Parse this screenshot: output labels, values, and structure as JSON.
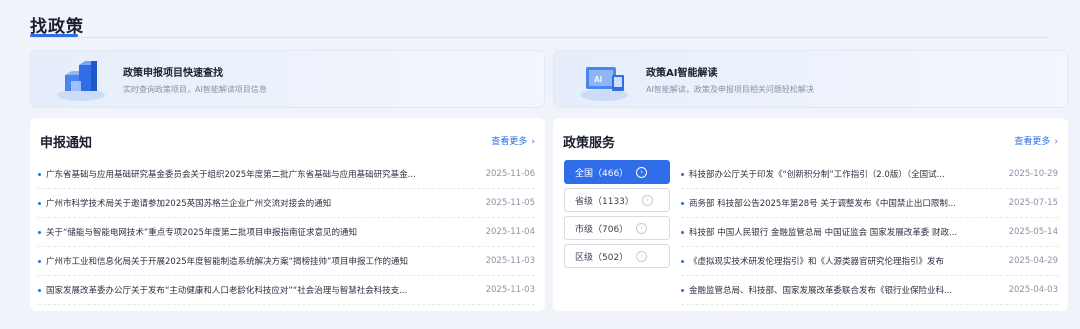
{
  "page": {
    "title": "找政策"
  },
  "banners": [
    {
      "title": "政策申报项目快速查找",
      "subtitle": "实时查询政策项目，AI智能解读项目信息"
    },
    {
      "title": "政策AI智能解读",
      "subtitle": "AI智能解读，政策及申报项目相关问题轻松解决"
    }
  ],
  "notices": {
    "title": "申报通知",
    "see_more": "查看更多",
    "items": [
      {
        "text": "广东省基础与应用基础研究基金委员会关于组织2025年度第二批广东省基础与应用基础研究基金...",
        "date": "2025-11-06"
      },
      {
        "text": "广州市科学技术局关于邀请参加2025英国苏格兰企业广州交流对接会的通知",
        "date": "2025-11-05"
      },
      {
        "text": "关于“储能与智能电网技术”重点专项2025年度第二批项目申报指南征求意见的通知",
        "date": "2025-11-04"
      },
      {
        "text": "广州市工业和信息化局关于开展2025年度智能制造系统解决方案“揭榜挂帅”项目申报工作的通知",
        "date": "2025-11-03"
      },
      {
        "text": "国家发展改革委办公厅关于发布“主动健康和人口老龄化科技应对”“社会治理与智慧社会科技支...",
        "date": "2025-11-03"
      }
    ]
  },
  "services": {
    "title": "政策服务",
    "see_more": "查看更多",
    "tabs": [
      {
        "label": "全国（466）",
        "active": true
      },
      {
        "label": "省级（1133）",
        "active": false
      },
      {
        "label": "市级（706）",
        "active": false
      },
      {
        "label": "区级（502）",
        "active": false
      }
    ],
    "items": [
      {
        "text": "科技部办公厅关于印发《“创新积分制”工作指引（2.0版）（全国试...",
        "date": "2025-10-29"
      },
      {
        "text": "商务部 科技部公告2025年第28号 关于调整发布《中国禁止出口限制...",
        "date": "2025-07-15"
      },
      {
        "text": "科技部 中国人民银行 金融监管总局 中国证监会 国家发展改革委 财政...",
        "date": "2025-05-14"
      },
      {
        "text": "《虚拟现实技术研发伦理指引》和《人源类器官研究伦理指引》发布",
        "date": "2025-04-29"
      },
      {
        "text": "金融监管总局、科技部、国家发展改革委联合发布《银行业保险业科...",
        "date": "2025-04-03"
      }
    ]
  },
  "colors": {
    "accent": "#2f6ee8",
    "background": "#f0f4fa",
    "muted": "#8a94a6"
  },
  "icons": {
    "tab_arrow": "circle-arrow-right-icon",
    "more": "chevron-right-icon"
  }
}
